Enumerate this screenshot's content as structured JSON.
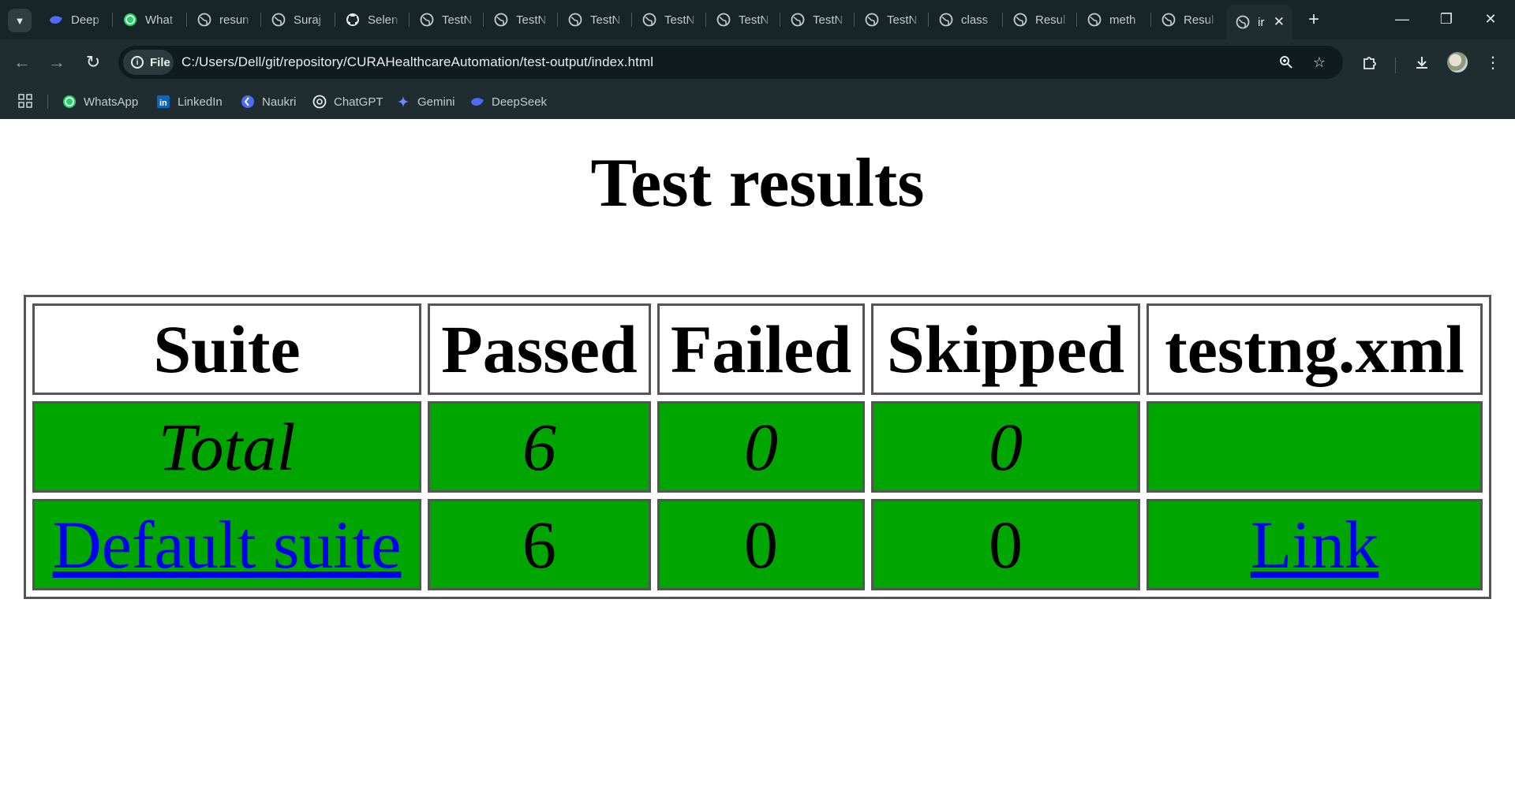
{
  "browser": {
    "tabs": [
      {
        "label": "Deep",
        "icon": "deepseek-icon"
      },
      {
        "label": "What",
        "icon": "whatsapp-icon"
      },
      {
        "label": "resun",
        "icon": "globe-icon"
      },
      {
        "label": "Suraj",
        "icon": "globe-icon"
      },
      {
        "label": "Selen",
        "icon": "github-icon"
      },
      {
        "label": "TestN",
        "icon": "globe-icon"
      },
      {
        "label": "TestN",
        "icon": "globe-icon"
      },
      {
        "label": "TestN",
        "icon": "globe-icon"
      },
      {
        "label": "TestN",
        "icon": "globe-icon"
      },
      {
        "label": "TestN",
        "icon": "globe-icon"
      },
      {
        "label": "TestN",
        "icon": "globe-icon"
      },
      {
        "label": "TestN",
        "icon": "globe-icon"
      },
      {
        "label": "class",
        "icon": "globe-icon"
      },
      {
        "label": "Resul",
        "icon": "globe-icon"
      },
      {
        "label": "meth",
        "icon": "globe-icon"
      },
      {
        "label": "Resul",
        "icon": "globe-icon"
      }
    ],
    "active_tab": {
      "label": "ir",
      "icon": "globe-icon"
    },
    "site_chip": "File",
    "url": "C:/Users/Dell/git/repository/CURAHealthcareAutomation/test-output/index.html",
    "bookmarks": [
      {
        "label": "WhatsApp",
        "icon": "whatsapp-icon"
      },
      {
        "label": "LinkedIn",
        "icon": "linkedin-icon"
      },
      {
        "label": "Naukri",
        "icon": "naukri-icon"
      },
      {
        "label": "ChatGPT",
        "icon": "chatgpt-icon"
      },
      {
        "label": "Gemini",
        "icon": "gemini-icon"
      },
      {
        "label": "DeepSeek",
        "icon": "deepseek-icon"
      }
    ]
  },
  "page": {
    "title": "Test results",
    "table": {
      "headers": [
        "Suite",
        "Passed",
        "Failed",
        "Skipped",
        "testng.xml"
      ],
      "total_row": {
        "label": "Total",
        "passed": "6",
        "failed": "0",
        "skipped": "0",
        "xml": ""
      },
      "suite_row": {
        "label": "Default suite",
        "passed": "6",
        "failed": "0",
        "skipped": "0",
        "xml": "Link"
      }
    }
  },
  "colors": {
    "pass_cell": "#00a600",
    "link": "#0000ee",
    "chrome_bg": "#1f2d31"
  }
}
